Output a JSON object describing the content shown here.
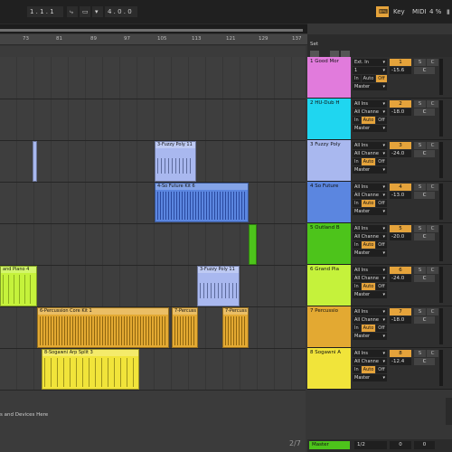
{
  "transport": {
    "position": "1 . 1 . 1",
    "length": "4 . 0 . 0"
  },
  "topright": {
    "key": "Key",
    "midi": "MIDI",
    "cpu": "4 %"
  },
  "ruler": {
    "bars": [
      "73",
      "81",
      "89",
      "97",
      "105",
      "113",
      "121",
      "129",
      "137"
    ]
  },
  "set_label": "Set",
  "drop_hint": "s and Devices Here",
  "bottom_number": "2/7",
  "colors": {
    "orange": "#e5a33b",
    "track1": "#e17bdc",
    "track2": "#1fd6f0",
    "track3": "#a9b8ef",
    "track4": "#5b86e0",
    "track5": "#4dc41b",
    "track6": "#c5f23b",
    "track7": "#e3a932",
    "track8": "#f1e43a"
  },
  "clips": [
    {
      "label": "3-Fuzzy Poly 11"
    },
    {
      "label": "4-So Future Kit 6"
    },
    {
      "label": "and Piano 4"
    },
    {
      "label": "3-Fuzzy Poly 11"
    },
    {
      "label": "6-Percussion Core Kit 1"
    },
    {
      "label": "7-Percuss"
    },
    {
      "label": "7-Percuss"
    },
    {
      "label": "8-Sogawni Arp Split 3"
    }
  ],
  "tracks": [
    {
      "name": "1 Good Mor",
      "in1": "Ext. In",
      "in2": "1",
      "out": "Master",
      "num": "1",
      "vol": "-15.6",
      "pan": "C"
    },
    {
      "name": "2 HU-Dub H",
      "in1": "All Ins",
      "in2": "All Channe",
      "out": "Master",
      "num": "2",
      "vol": "-18.0",
      "pan": "C"
    },
    {
      "name": "3 Fuzzy Poly",
      "in1": "All Ins",
      "in2": "All Channe",
      "out": "Master",
      "num": "3",
      "vol": "-24.0",
      "pan": "C"
    },
    {
      "name": "4 So Future",
      "in1": "All Ins",
      "in2": "All Channe",
      "out": "Master",
      "num": "4",
      "vol": "-13.0",
      "pan": "C"
    },
    {
      "name": "5 Outland B",
      "in1": "All Ins",
      "in2": "All Channe",
      "out": "Master",
      "num": "5",
      "vol": "-20.0",
      "pan": "C"
    },
    {
      "name": "6 Grand Pia",
      "in1": "All Ins",
      "in2": "All Channe",
      "out": "Master",
      "num": "6",
      "vol": "-24.0",
      "pan": "C"
    },
    {
      "name": "7 Percussio",
      "in1": "All Ins",
      "in2": "All Channe",
      "out": "Master",
      "num": "7",
      "vol": "-18.0",
      "pan": "C"
    },
    {
      "name": "8 Sogawni A",
      "in1": "All Ins",
      "in2": "All Channe",
      "out": "Master",
      "num": "8",
      "vol": "-12.4",
      "pan": "C"
    }
  ],
  "monitor": {
    "in": "In",
    "auto": "Auto",
    "off": "Off"
  },
  "btn": {
    "s": "S",
    "c": "C"
  },
  "master": {
    "name": "Master",
    "fraction": "1/2",
    "v1": "0",
    "v2": "0"
  }
}
